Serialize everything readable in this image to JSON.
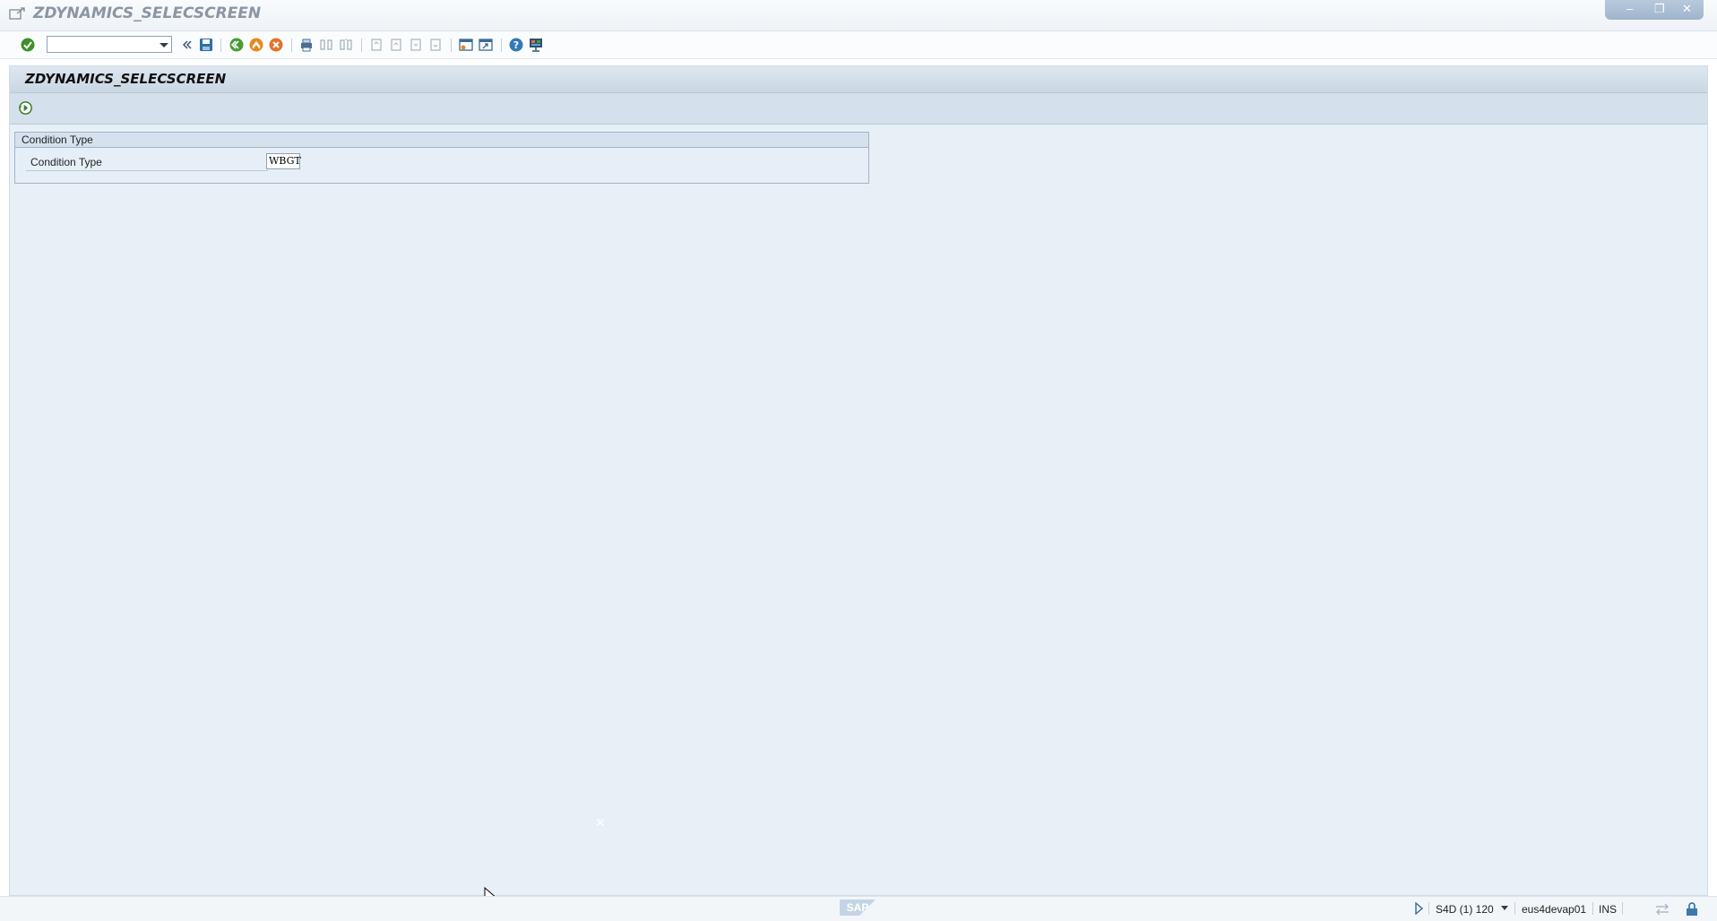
{
  "window": {
    "title": "ZDYNAMICS_SELECSCREEN",
    "controls": {
      "minimize": "–",
      "maximize": "❐",
      "close": "✕"
    }
  },
  "toolbar": {
    "command_field_value": "",
    "icons": [
      "enter-icon",
      "command-field",
      "collapse-icon",
      "save-icon",
      "back-icon",
      "exit-icon",
      "cancel-icon",
      "print-icon",
      "find-icon",
      "find-next-icon",
      "first-page-icon",
      "previous-page-icon",
      "next-page-icon",
      "last-page-icon",
      "create-session-icon",
      "shortcut-icon",
      "help-icon",
      "customize-layout-icon"
    ]
  },
  "screen": {
    "title": "ZDYNAMICS_SELECSCREEN",
    "execute_icon": "execute-icon"
  },
  "groupbox": {
    "title": "Condition Type",
    "field_label": "Condition Type",
    "field_value": "WBGT"
  },
  "statusbar": {
    "logo": "SAP",
    "system": "S4D (1) 120",
    "server": "eus4devap01",
    "mode": "INS"
  },
  "colors": {
    "background": "#e8f0f7",
    "title_bar": "#c9d7e4",
    "accent_green": "#3a8a2e",
    "accent_orange": "#e08a1e"
  }
}
